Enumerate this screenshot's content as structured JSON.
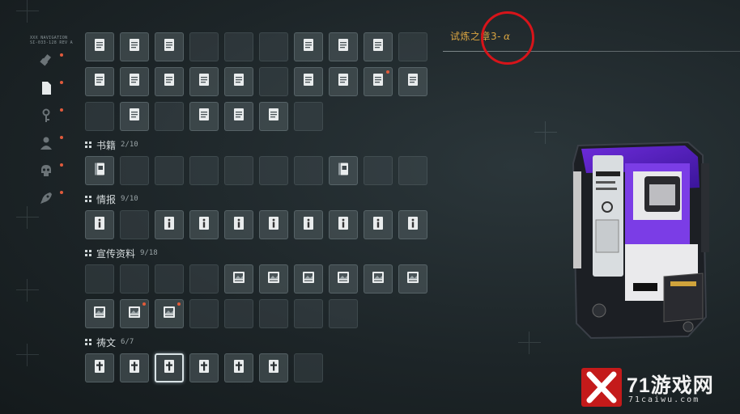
{
  "sidebar": {
    "header_text": [
      "XXX NAVIGATION",
      "SI-033-128 REV A"
    ],
    "items": [
      {
        "icon": "usb-icon",
        "badge": true
      },
      {
        "icon": "document-icon",
        "badge": true,
        "active": true
      },
      {
        "icon": "key-icon",
        "badge": true
      },
      {
        "icon": "person-icon",
        "badge": true
      },
      {
        "icon": "skull-icon",
        "badge": true
      },
      {
        "icon": "rocket-icon",
        "badge": true
      }
    ]
  },
  "collection": {
    "top_rows": [
      [
        {
          "f": "doc"
        },
        {
          "f": "doc"
        },
        {
          "f": "doc"
        },
        {
          "f": ""
        },
        {
          "f": ""
        },
        {
          "f": ""
        },
        {
          "f": "doc"
        },
        {
          "f": "doc"
        },
        {
          "f": "doc"
        },
        {
          "f": ""
        }
      ],
      [
        {
          "f": "doc"
        },
        {
          "f": "doc"
        },
        {
          "f": "doc"
        },
        {
          "f": "doc"
        },
        {
          "f": "doc"
        },
        {
          "f": ""
        },
        {
          "f": "doc"
        },
        {
          "f": "doc"
        },
        {
          "f": "doc",
          "dot": true
        },
        {
          "f": "doc"
        }
      ],
      [
        {
          "f": ""
        },
        {
          "f": "doc"
        },
        {
          "f": ""
        },
        {
          "f": "doc"
        },
        {
          "f": "doc"
        },
        {
          "f": "doc"
        },
        {
          "f": ""
        }
      ]
    ],
    "sections": [
      {
        "title": "书籍",
        "count": "2/10",
        "rows": [
          [
            {
              "f": "book"
            },
            {
              "f": ""
            },
            {
              "f": ""
            },
            {
              "f": ""
            },
            {
              "f": ""
            },
            {
              "f": ""
            },
            {
              "f": ""
            },
            {
              "f": "book"
            },
            {
              "f": ""
            },
            {
              "f": ""
            }
          ]
        ]
      },
      {
        "title": "情报",
        "count": "9/10",
        "rows": [
          [
            {
              "f": "info"
            },
            {
              "f": ""
            },
            {
              "f": "info"
            },
            {
              "f": "info"
            },
            {
              "f": "info"
            },
            {
              "f": "info"
            },
            {
              "f": "info"
            },
            {
              "f": "info"
            },
            {
              "f": "info"
            },
            {
              "f": "info"
            }
          ]
        ]
      },
      {
        "title": "宣传资料",
        "count": "9/18",
        "rows": [
          [
            {
              "f": ""
            },
            {
              "f": ""
            },
            {
              "f": ""
            },
            {
              "f": ""
            },
            {
              "f": "image"
            },
            {
              "f": "image"
            },
            {
              "f": "image"
            },
            {
              "f": "image"
            },
            {
              "f": "image"
            },
            {
              "f": "image"
            }
          ],
          [
            {
              "f": "image"
            },
            {
              "f": "image",
              "dot": true
            },
            {
              "f": "image",
              "dot": true
            },
            {
              "f": ""
            },
            {
              "f": ""
            },
            {
              "f": ""
            },
            {
              "f": ""
            },
            {
              "f": ""
            }
          ]
        ]
      },
      {
        "title": "祷文",
        "count": "6/7",
        "rows": [
          [
            {
              "f": "cross"
            },
            {
              "f": "cross"
            },
            {
              "f": "cross",
              "selected": true
            },
            {
              "f": "cross"
            },
            {
              "f": "cross"
            },
            {
              "f": "cross"
            },
            {
              "f": ""
            }
          ]
        ]
      }
    ]
  },
  "detail": {
    "title": "试炼之章3-",
    "title_suffix": "α",
    "accent_color": "#d9a441"
  },
  "watermark": {
    "brand": "71游戏网",
    "domain": "71caiwu.com"
  }
}
